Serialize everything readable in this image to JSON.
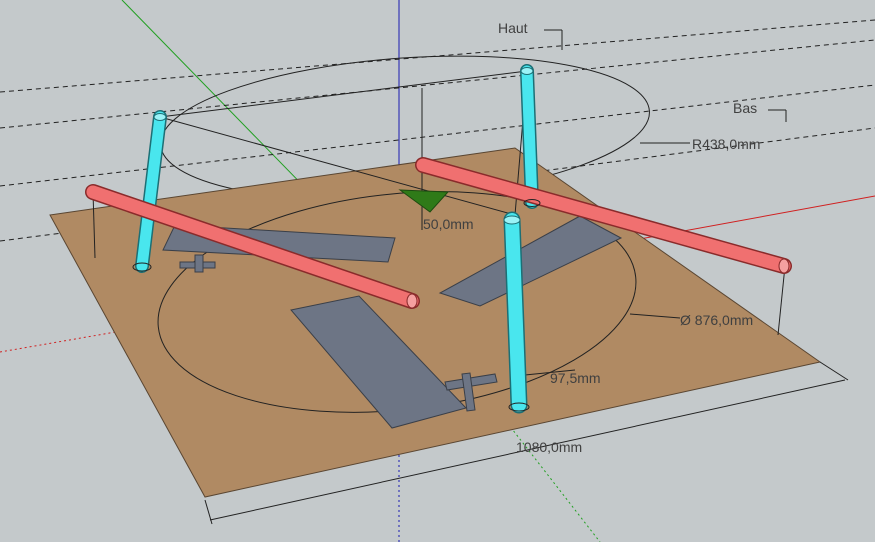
{
  "labels": {
    "haut": "Haut",
    "bas": "Bas"
  },
  "dimensions": {
    "radius": "R438,0mm",
    "height": "50,0mm",
    "diameter": "Ø 876,0mm",
    "small_offset": "97,5mm",
    "board_length": "1080,0mm"
  },
  "colors": {
    "background": "#c4c9cb",
    "board": "#b08a63",
    "plate": "#6d7585",
    "leg": "#49e6ee",
    "rail": "#f07070",
    "axis_red": "#d02020",
    "axis_green": "#22a022",
    "axis_blue": "#1a1ab0"
  }
}
